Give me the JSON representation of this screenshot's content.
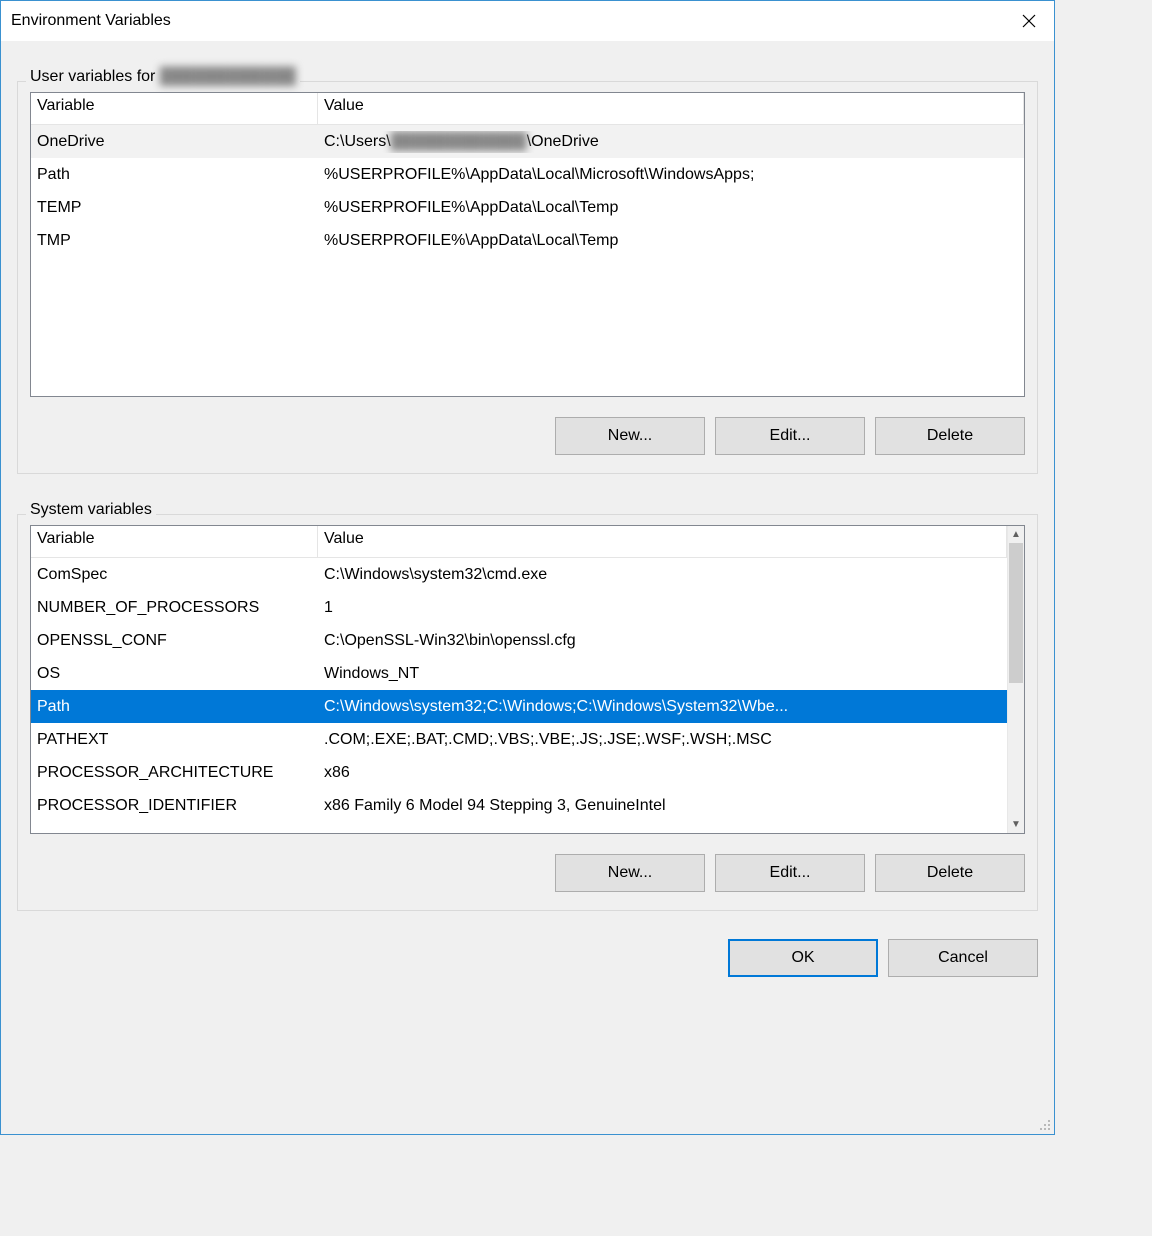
{
  "window": {
    "title": "Environment Variables"
  },
  "user_section": {
    "legend_prefix": "User variables for ",
    "legend_redacted": "████████████",
    "columns": {
      "variable": "Variable",
      "value": "Value"
    },
    "rows": [
      {
        "variable": "OneDrive",
        "value_prefix": "C:\\Users\\",
        "value_redacted": "████████████",
        "value_suffix": "\\OneDrive",
        "hover": true
      },
      {
        "variable": "Path",
        "value": "%USERPROFILE%\\AppData\\Local\\Microsoft\\WindowsApps;"
      },
      {
        "variable": "TEMP",
        "value": "%USERPROFILE%\\AppData\\Local\\Temp"
      },
      {
        "variable": "TMP",
        "value": "%USERPROFILE%\\AppData\\Local\\Temp"
      }
    ],
    "buttons": {
      "new": "New...",
      "edit": "Edit...",
      "delete": "Delete"
    }
  },
  "system_section": {
    "legend": "System variables",
    "columns": {
      "variable": "Variable",
      "value": "Value"
    },
    "rows": [
      {
        "variable": "ComSpec",
        "value": "C:\\Windows\\system32\\cmd.exe"
      },
      {
        "variable": "NUMBER_OF_PROCESSORS",
        "value": "1"
      },
      {
        "variable": "OPENSSL_CONF",
        "value": "C:\\OpenSSL-Win32\\bin\\openssl.cfg"
      },
      {
        "variable": "OS",
        "value": "Windows_NT"
      },
      {
        "variable": "Path",
        "value": "C:\\Windows\\system32;C:\\Windows;C:\\Windows\\System32\\Wbe...",
        "selected": true
      },
      {
        "variable": "PATHEXT",
        "value": ".COM;.EXE;.BAT;.CMD;.VBS;.VBE;.JS;.JSE;.WSF;.WSH;.MSC"
      },
      {
        "variable": "PROCESSOR_ARCHITECTURE",
        "value": "x86"
      },
      {
        "variable": "PROCESSOR_IDENTIFIER",
        "value": "x86 Family 6 Model 94 Stepping 3, GenuineIntel"
      }
    ],
    "buttons": {
      "new": "New...",
      "edit": "Edit...",
      "delete": "Delete"
    }
  },
  "footer": {
    "ok": "OK",
    "cancel": "Cancel"
  }
}
